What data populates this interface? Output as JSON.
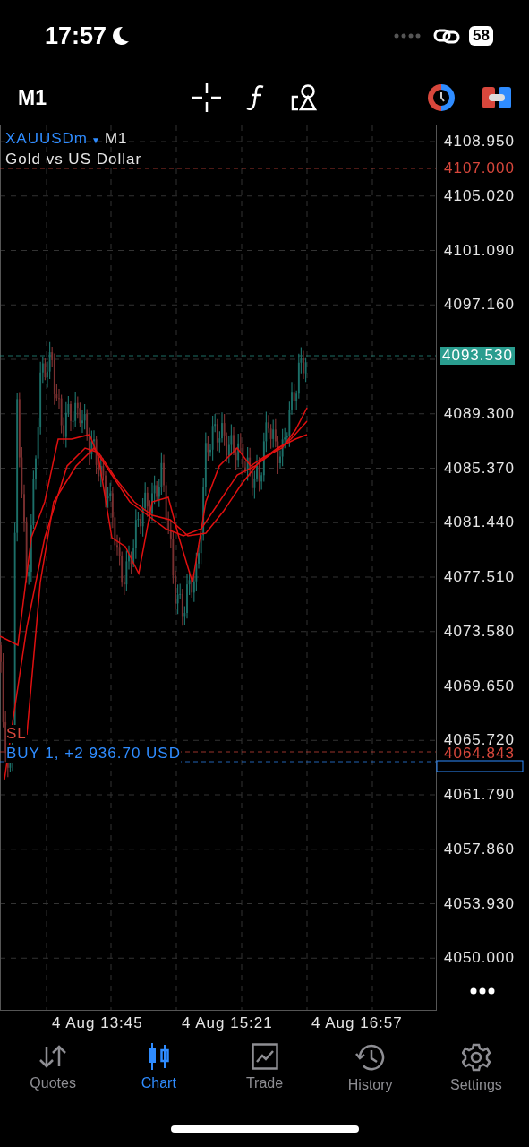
{
  "status_bar": {
    "time": "17:57",
    "battery": "58"
  },
  "toolbar": {
    "timeframe": "M1"
  },
  "chart": {
    "symbol": "XAUUSDm",
    "dropdown": "▼",
    "timeframe": "M1",
    "description": "Gold vs US Dollar",
    "price_axis": [
      "4108.950",
      "4105.020",
      "4101.090",
      "4097.160",
      "4089.300",
      "4085.370",
      "4081.440",
      "4077.510",
      "4073.580",
      "4069.650",
      "4065.720",
      "4061.790",
      "4057.860",
      "4053.930",
      "4050.000"
    ],
    "markers": [
      {
        "kind": "alert",
        "label": "4107.000"
      },
      {
        "kind": "bid",
        "label": "4093.530"
      },
      {
        "kind": "stop_loss",
        "label": "4064.843",
        "tag": "SL"
      },
      {
        "kind": "position",
        "label": "BUY 1, +2 936.70 USD"
      }
    ],
    "time_axis": [
      "4 Aug 13:45",
      "4 Aug 15:21",
      "4 Aug 16:57"
    ]
  },
  "tabs": [
    {
      "label": "Quotes",
      "selected": false
    },
    {
      "label": "Chart",
      "selected": true
    },
    {
      "label": "Trade",
      "selected": false
    },
    {
      "label": "History",
      "selected": false
    },
    {
      "label": "Settings",
      "selected": false
    }
  ]
}
